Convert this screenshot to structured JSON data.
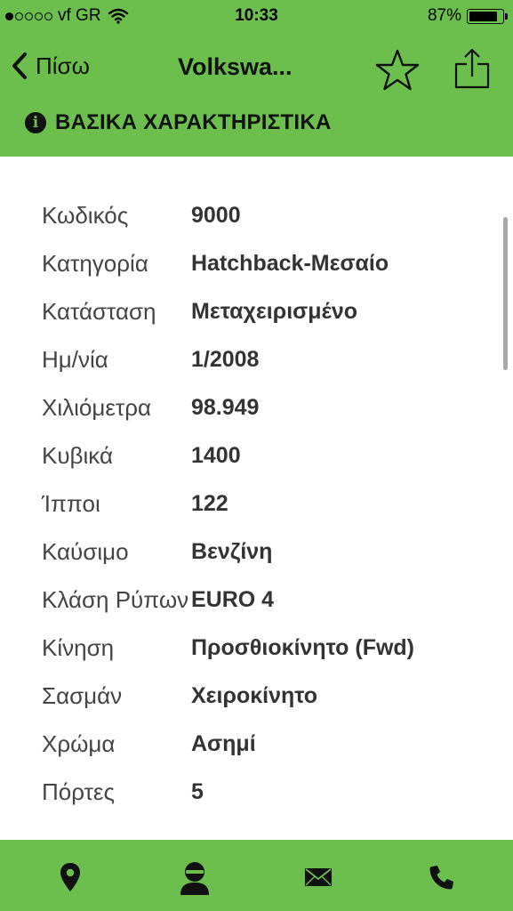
{
  "status_bar": {
    "carrier": "vf GR",
    "time": "10:33",
    "battery_percent": "87%",
    "battery_level": 0.87,
    "signal_bars_filled": 1,
    "signal_bars_total": 5
  },
  "navbar": {
    "back_label": "Πίσω",
    "title": "Volkswa...",
    "icons": [
      "chevron-left-icon",
      "star-outline-icon",
      "share-icon"
    ]
  },
  "section": {
    "icon": "info-icon",
    "title": "ΒΑΣΙΚΑ ΧΑΡΑΚΤΗΡΙΣΤΙΚΑ"
  },
  "specs": [
    {
      "label": "Κωδικός",
      "value": "9000"
    },
    {
      "label": "Κατηγορία",
      "value": "Hatchback-Μεσαίο"
    },
    {
      "label": "Κατάσταση",
      "value": "Μεταχειρισμένο"
    },
    {
      "label": "Ημ/νία",
      "value": "1/2008"
    },
    {
      "label": "Χιλιόμετρα",
      "value": "98.949"
    },
    {
      "label": "Κυβικά",
      "value": "1400"
    },
    {
      "label": "Ίπποι",
      "value": "122"
    },
    {
      "label": "Καύσιμο",
      "value": "Βενζίνη"
    },
    {
      "label": "Κλάση Ρύπων",
      "value": "EURO 4"
    },
    {
      "label": "Κίνηση",
      "value": "Προσθιοκίνητο (Fwd)"
    },
    {
      "label": "Σασμάν",
      "value": "Χειροκίνητο"
    },
    {
      "label": "Χρώμα",
      "value": "Ασημί"
    },
    {
      "label": "Πόρτες",
      "value": "5"
    }
  ],
  "tabbar": {
    "tabs": [
      "location-pin-icon",
      "person-icon",
      "envelope-icon",
      "phone-icon"
    ]
  },
  "colors": {
    "accent": "#6cbf4c",
    "text_dark": "#111111",
    "label": "#444444",
    "background": "#ffffff"
  }
}
